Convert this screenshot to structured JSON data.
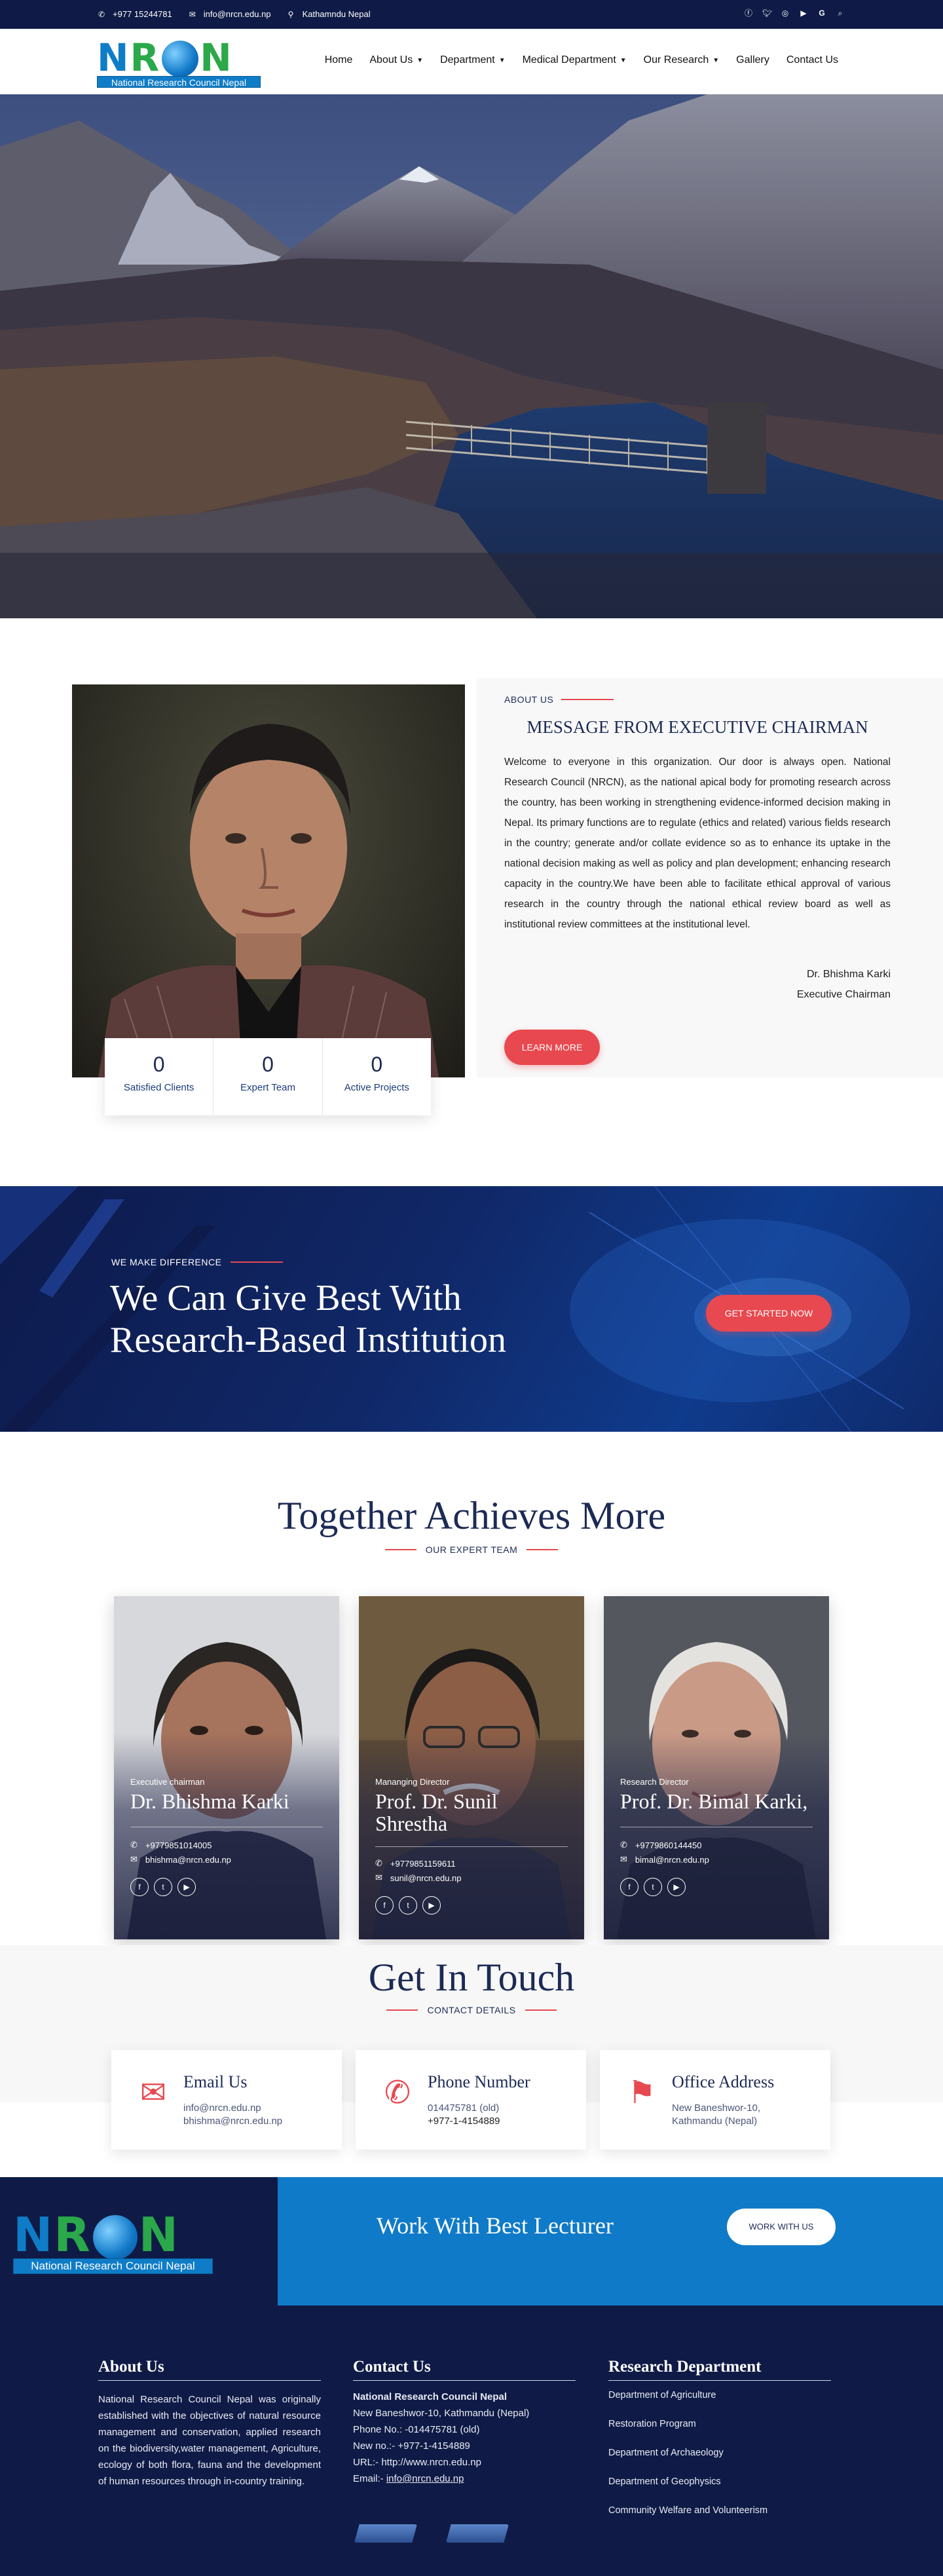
{
  "topbar": {
    "phone": "+977 15244781",
    "email": "info@nrcn.edu.np",
    "location": "Kathamndu Nepal"
  },
  "logo": {
    "letters": [
      "N",
      "R",
      "C",
      "N"
    ],
    "tagline": "National Research Council Nepal"
  },
  "nav": {
    "items": [
      {
        "label": "Home"
      },
      {
        "label": "About Us"
      },
      {
        "label": "Department"
      },
      {
        "label": "Medical Department"
      },
      {
        "label": "Our Research"
      },
      {
        "label": "Gallery"
      },
      {
        "label": "Contact Us"
      }
    ]
  },
  "about": {
    "label": "ABOUT US",
    "title": "MESSAGE FROM EXECUTIVE CHAIRMAN",
    "text": "Welcome to everyone in this organization. Our door is always open. National Research Council (NRCN), as the national apical body for promoting research across the country, has been working in strengthening evidence-informed decision making in Nepal. Its primary functions are to regulate (ethics and related) various fields research in the country; generate and/or collate evidence so as to enhance its uptake in the national decision making as well as policy and plan development; enhancing research capacity in the country.We have been able to facilitate ethical approval of various research in the country through the national ethical review board as well as institutional review committees at the institutional level.",
    "signature_name": "Dr. Bhishma Karki",
    "signature_role": "Executive Chairman",
    "button": "LEARN MORE",
    "stats": [
      {
        "value": "0",
        "label": "Satisfied Clients"
      },
      {
        "value": "0",
        "label": "Expert Team"
      },
      {
        "value": "0",
        "label": "Active Projects"
      }
    ]
  },
  "cta": {
    "label": "WE MAKE DIFFERENCE",
    "title_line1": "We Can Give Best With",
    "title_line2": "Research-Based Institution",
    "button": "GET STARTED NOW"
  },
  "team": {
    "title": "Together Achieves More",
    "subtitle": "OUR EXPERT TEAM",
    "members": [
      {
        "role": "Executive chairman",
        "name": "Dr. Bhishma Karki",
        "phone": "+9779851014005",
        "email": "bhishma@nrcn.edu.np"
      },
      {
        "role": "Mananging Director",
        "name": "Prof. Dr. Sunil Shrestha",
        "phone": "+9779851159611",
        "email": "sunil@nrcn.edu.np"
      },
      {
        "role": "Research Director",
        "name": "Prof. Dr. Bimal Karki,",
        "phone": "+9779860144450",
        "email": "bimal@nrcn.edu.np"
      }
    ]
  },
  "contact": {
    "title": "Get In Touch",
    "subtitle": "CONTACT DETAILS",
    "cards": [
      {
        "icon": "envelope-icon",
        "title": "Email Us",
        "line1": "info@nrcn.edu.np",
        "line2": "bhishma@nrcn.edu.np"
      },
      {
        "icon": "phone-icon",
        "title": "Phone Number",
        "line1": "014475781 (old)",
        "line2": "+977-1-4154889"
      },
      {
        "icon": "map-marker-icon",
        "title": "Office Address",
        "line1": "New Baneshwor-10,",
        "line2": "Kathmandu (Nepal)"
      }
    ]
  },
  "banner": {
    "text": "Work With Best Lecturer",
    "button": "WORK WITH US"
  },
  "footer": {
    "about_title": "About Us",
    "about_text": "National Research Council Nepal was originally established with the objectives of natural resource management and conservation, applied research on the biodiversity,water management, Agriculture, ecology of both flora, fauna and the development of human resources through in-country training.",
    "contact_title": "Contact Us",
    "contact_org": "National Research Council Nepal",
    "contact_address": "New Baneshwor-10, Kathmandu (Nepal)",
    "contact_phone": "Phone No.: -014475781 (old)",
    "contact_new": "New no.:- +977-1-4154889",
    "contact_url": "URL:- http://www.nrcn.edu.np",
    "contact_email_label": "Email:- ",
    "contact_email": "info@nrcn.edu.np",
    "research_title": "Research Department",
    "research_items": [
      "Department of Agriculture",
      "Restoration Program",
      "Department of Archaeology",
      "Department of Geophysics",
      "Community Welfare and Volunteerism"
    ]
  },
  "colors": {
    "navy": "#0f1b46",
    "accent_red": "#e8484f",
    "blue": "#0f7ac8",
    "heading": "#1c2a55"
  }
}
